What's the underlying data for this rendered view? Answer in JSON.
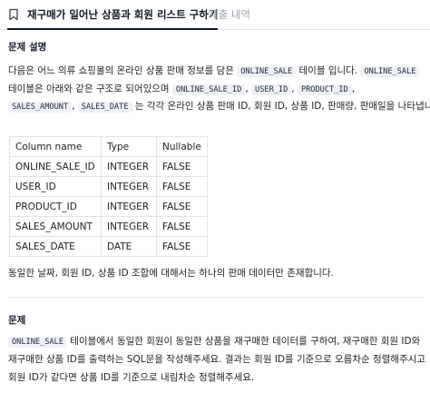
{
  "tabs": [
    {
      "label": "재구매가 일어난 상품과 회원 리스트 구하기",
      "active": true
    },
    {
      "label": "제출 내역",
      "active": false
    }
  ],
  "section1": {
    "heading": "문제 설명",
    "line1": {
      "t1": "다음은 어느 의류 쇼핑몰의 온라인 상품 판매 정보를 담은",
      "c1": "ONLINE_SALE",
      "t2": "테이블 입니다.",
      "c2": "ONLINE_SALE"
    },
    "line2": {
      "t1": "테이블은 아래와 같은 구조로 되어있으며",
      "c1": "ONLINE_SALE_ID",
      "t2": ",",
      "c2": "USER_ID",
      "t3": ",",
      "c3": "PRODUCT_ID",
      "t4": ","
    },
    "line3": {
      "c1": "SALES_AMOUNT",
      "t1": ",",
      "c2": "SALES_DATE",
      "t2": "는 각각 온라인 상품 판매 ID, 회원 ID, 상품 ID, 판매량, 판매일을 나타냅니다."
    }
  },
  "table": {
    "headers": [
      "Column name",
      "Type",
      "Nullable"
    ],
    "rows": [
      [
        "ONLINE_SALE_ID",
        "INTEGER",
        "FALSE"
      ],
      [
        "USER_ID",
        "INTEGER",
        "FALSE"
      ],
      [
        "PRODUCT_ID",
        "INTEGER",
        "FALSE"
      ],
      [
        "SALES_AMOUNT",
        "INTEGER",
        "FALSE"
      ],
      [
        "SALES_DATE",
        "DATE",
        "FALSE"
      ]
    ]
  },
  "note": "동일한 날짜, 회원 ID, 상품 ID 조합에 대해서는 하나의 판매 데이터만 존재합니다.",
  "section2": {
    "heading": "문제",
    "line1": {
      "c1": "ONLINE_SALE",
      "t1": "테이블에서 동일한 회원이 동일한 상품을 재구매한 데이터를 구하여, 재구매한 회원 ID와"
    },
    "line2": "재구매한 상품 ID를 출력하는 SQL문을 작성해주세요. 결과는 회원 ID를 기준으로 오름차순 정렬해주시고",
    "line3": "회원 ID가 같다면 상품 ID를 기준으로 내림차순 정렬해주세요."
  }
}
